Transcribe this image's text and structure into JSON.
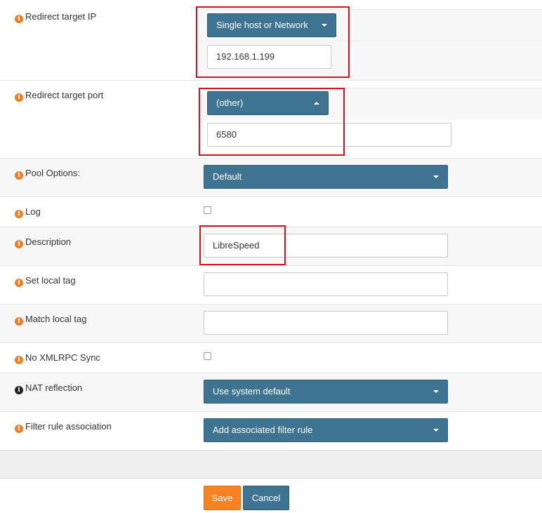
{
  "form": {
    "redirect_target_ip": {
      "label": "Redirect target IP",
      "type_select": "Single host or Network",
      "value": "192.168.1.199"
    },
    "redirect_target_port": {
      "label": "Redirect target port",
      "type_select": "(other)",
      "value": "6580"
    },
    "pool_options": {
      "label": "Pool Options:",
      "value": "Default"
    },
    "log": {
      "label": "Log",
      "checked": false
    },
    "description": {
      "label": "Description",
      "value": "LibreSpeed"
    },
    "set_local_tag": {
      "label": "Set local tag",
      "value": ""
    },
    "match_local_tag": {
      "label": "Match local tag",
      "value": ""
    },
    "no_xmlrpc_sync": {
      "label": "No XMLRPC Sync",
      "checked": false
    },
    "nat_reflection": {
      "label": "NAT reflection",
      "value": "Use system default"
    },
    "filter_rule_association": {
      "label": "Filter rule association",
      "value": "Add associated filter rule"
    }
  },
  "buttons": {
    "save": "Save",
    "cancel": "Cancel"
  },
  "info_glyph": "i",
  "colors": {
    "select_bg": "#3f7392",
    "save_bg": "#f78222",
    "cancel_bg": "#3f7392",
    "info_orange": "#f27d21",
    "highlight_red": "#d9101e"
  }
}
